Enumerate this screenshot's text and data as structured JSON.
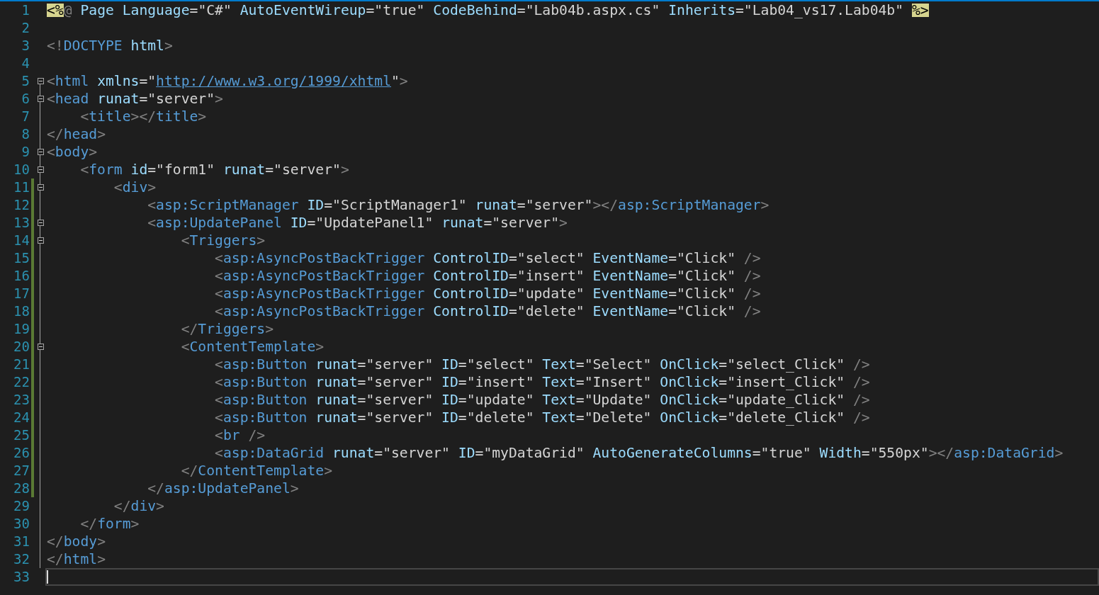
{
  "editor": {
    "lines": [
      {
        "number": "1",
        "collapsible": false,
        "guide": false,
        "modified": false,
        "current": false,
        "tokens": [
          {
            "kind": "directive",
            "text": "<%"
          },
          {
            "kind": "delim",
            "text": "@ "
          },
          {
            "kind": "attr",
            "text": "Page Language"
          },
          {
            "kind": "value",
            "text": "=\"C#\" "
          },
          {
            "kind": "attr",
            "text": "AutoEventWireup"
          },
          {
            "kind": "value",
            "text": "=\"true\" "
          },
          {
            "kind": "attr",
            "text": "CodeBehind"
          },
          {
            "kind": "value",
            "text": "=\"Lab04b.aspx.cs\" "
          },
          {
            "kind": "attr",
            "text": "Inherits"
          },
          {
            "kind": "value",
            "text": "=\"Lab04_vs17.Lab04b\" "
          },
          {
            "kind": "directive",
            "text": "%>"
          }
        ]
      },
      {
        "number": "2",
        "collapsible": false,
        "guide": false,
        "modified": false,
        "current": false
      },
      {
        "number": "3",
        "collapsible": false,
        "guide": false,
        "modified": false,
        "current": false,
        "tokens": [
          {
            "kind": "delim",
            "text": "<!"
          },
          {
            "kind": "tag",
            "text": "DOCTYPE "
          },
          {
            "kind": "attr",
            "text": "html"
          },
          {
            "kind": "delim",
            "text": ">"
          }
        ]
      },
      {
        "number": "4",
        "collapsible": false,
        "guide": false,
        "modified": false,
        "current": false
      },
      {
        "number": "5",
        "collapsible": true,
        "guide": false,
        "modified": false,
        "current": false,
        "tokens": [
          {
            "kind": "delim",
            "text": "<"
          },
          {
            "kind": "tag",
            "text": "html "
          },
          {
            "kind": "attr",
            "text": "xmlns"
          },
          {
            "kind": "value",
            "text": "=\""
          },
          {
            "kind": "link",
            "text": "http://www.w3.org/1999/xhtml"
          },
          {
            "kind": "value",
            "text": "\""
          },
          {
            "kind": "delim",
            "text": ">"
          }
        ]
      },
      {
        "number": "6",
        "collapsible": true,
        "guide": true,
        "modified": false,
        "current": false,
        "tokens": [
          {
            "kind": "delim",
            "text": "<"
          },
          {
            "kind": "tag",
            "text": "head "
          },
          {
            "kind": "attr",
            "text": "runat"
          },
          {
            "kind": "value",
            "text": "=\"server\""
          },
          {
            "kind": "delim",
            "text": ">"
          }
        ]
      },
      {
        "number": "7",
        "collapsible": false,
        "guide": true,
        "modified": false,
        "current": false,
        "tokens": [
          {
            "kind": "delim",
            "text": "    <"
          },
          {
            "kind": "tag",
            "text": "title"
          },
          {
            "kind": "delim",
            "text": "></"
          },
          {
            "kind": "tag",
            "text": "title"
          },
          {
            "kind": "delim",
            "text": ">"
          }
        ]
      },
      {
        "number": "8",
        "collapsible": false,
        "guide": true,
        "modified": false,
        "current": false,
        "tokens": [
          {
            "kind": "delim",
            "text": "</"
          },
          {
            "kind": "tag",
            "text": "head"
          },
          {
            "kind": "delim",
            "text": ">"
          }
        ]
      },
      {
        "number": "9",
        "collapsible": true,
        "guide": true,
        "modified": false,
        "current": false,
        "tokens": [
          {
            "kind": "delim",
            "text": "<"
          },
          {
            "kind": "tag",
            "text": "body"
          },
          {
            "kind": "delim",
            "text": ">"
          }
        ]
      },
      {
        "number": "10",
        "collapsible": true,
        "guide": true,
        "modified": false,
        "current": false,
        "tokens": [
          {
            "kind": "delim",
            "text": "    <"
          },
          {
            "kind": "tag",
            "text": "form "
          },
          {
            "kind": "attr",
            "text": "id"
          },
          {
            "kind": "value",
            "text": "=\"form1\" "
          },
          {
            "kind": "attr",
            "text": "runat"
          },
          {
            "kind": "value",
            "text": "=\"server\""
          },
          {
            "kind": "delim",
            "text": ">"
          }
        ]
      },
      {
        "number": "11",
        "collapsible": true,
        "guide": true,
        "modified": true,
        "current": false,
        "tokens": [
          {
            "kind": "delim",
            "text": "        <"
          },
          {
            "kind": "tag",
            "text": "div"
          },
          {
            "kind": "delim",
            "text": ">"
          }
        ]
      },
      {
        "number": "12",
        "collapsible": false,
        "guide": true,
        "modified": true,
        "current": false,
        "tokens": [
          {
            "kind": "delim",
            "text": "            <"
          },
          {
            "kind": "tag",
            "text": "asp:ScriptManager "
          },
          {
            "kind": "attr",
            "text": "ID"
          },
          {
            "kind": "value",
            "text": "=\"ScriptManager1\" "
          },
          {
            "kind": "attr",
            "text": "runat"
          },
          {
            "kind": "value",
            "text": "=\"server\""
          },
          {
            "kind": "delim",
            "text": "></"
          },
          {
            "kind": "tag",
            "text": "asp:ScriptManager"
          },
          {
            "kind": "delim",
            "text": ">"
          }
        ]
      },
      {
        "number": "13",
        "collapsible": true,
        "guide": true,
        "modified": true,
        "current": false,
        "tokens": [
          {
            "kind": "delim",
            "text": "            <"
          },
          {
            "kind": "tag",
            "text": "asp:UpdatePanel "
          },
          {
            "kind": "attr",
            "text": "ID"
          },
          {
            "kind": "value",
            "text": "=\"UpdatePanel1\" "
          },
          {
            "kind": "attr",
            "text": "runat"
          },
          {
            "kind": "value",
            "text": "=\"server\""
          },
          {
            "kind": "delim",
            "text": ">"
          }
        ]
      },
      {
        "number": "14",
        "collapsible": true,
        "guide": true,
        "modified": true,
        "current": false,
        "tokens": [
          {
            "kind": "delim",
            "text": "                <"
          },
          {
            "kind": "tag",
            "text": "Triggers"
          },
          {
            "kind": "delim",
            "text": ">"
          }
        ]
      },
      {
        "number": "15",
        "collapsible": false,
        "guide": true,
        "modified": true,
        "current": false,
        "tokens": [
          {
            "kind": "delim",
            "text": "                    <"
          },
          {
            "kind": "tag",
            "text": "asp:AsyncPostBackTrigger "
          },
          {
            "kind": "attr",
            "text": "ControlID"
          },
          {
            "kind": "value",
            "text": "=\"select\" "
          },
          {
            "kind": "attr",
            "text": "EventName"
          },
          {
            "kind": "value",
            "text": "=\"Click\" "
          },
          {
            "kind": "delim",
            "text": "/>"
          }
        ]
      },
      {
        "number": "16",
        "collapsible": false,
        "guide": true,
        "modified": true,
        "current": false,
        "tokens": [
          {
            "kind": "delim",
            "text": "                    <"
          },
          {
            "kind": "tag",
            "text": "asp:AsyncPostBackTrigger "
          },
          {
            "kind": "attr",
            "text": "ControlID"
          },
          {
            "kind": "value",
            "text": "=\"insert\" "
          },
          {
            "kind": "attr",
            "text": "EventName"
          },
          {
            "kind": "value",
            "text": "=\"Click\" "
          },
          {
            "kind": "delim",
            "text": "/>"
          }
        ]
      },
      {
        "number": "17",
        "collapsible": false,
        "guide": true,
        "modified": true,
        "current": false,
        "tokens": [
          {
            "kind": "delim",
            "text": "                    <"
          },
          {
            "kind": "tag",
            "text": "asp:AsyncPostBackTrigger "
          },
          {
            "kind": "attr",
            "text": "ControlID"
          },
          {
            "kind": "value",
            "text": "=\"update\" "
          },
          {
            "kind": "attr",
            "text": "EventName"
          },
          {
            "kind": "value",
            "text": "=\"Click\" "
          },
          {
            "kind": "delim",
            "text": "/>"
          }
        ]
      },
      {
        "number": "18",
        "collapsible": false,
        "guide": true,
        "modified": true,
        "current": false,
        "tokens": [
          {
            "kind": "delim",
            "text": "                    <"
          },
          {
            "kind": "tag",
            "text": "asp:AsyncPostBackTrigger "
          },
          {
            "kind": "attr",
            "text": "ControlID"
          },
          {
            "kind": "value",
            "text": "=\"delete\" "
          },
          {
            "kind": "attr",
            "text": "EventName"
          },
          {
            "kind": "value",
            "text": "=\"Click\" "
          },
          {
            "kind": "delim",
            "text": "/>"
          }
        ]
      },
      {
        "number": "19",
        "collapsible": false,
        "guide": true,
        "modified": true,
        "current": false,
        "tokens": [
          {
            "kind": "delim",
            "text": "                </"
          },
          {
            "kind": "tag",
            "text": "Triggers"
          },
          {
            "kind": "delim",
            "text": ">"
          }
        ]
      },
      {
        "number": "20",
        "collapsible": true,
        "guide": true,
        "modified": true,
        "current": false,
        "tokens": [
          {
            "kind": "delim",
            "text": "                <"
          },
          {
            "kind": "tag",
            "text": "ContentTemplate"
          },
          {
            "kind": "delim",
            "text": ">"
          }
        ]
      },
      {
        "number": "21",
        "collapsible": false,
        "guide": true,
        "modified": true,
        "current": false,
        "tokens": [
          {
            "kind": "delim",
            "text": "                    <"
          },
          {
            "kind": "tag",
            "text": "asp:Button "
          },
          {
            "kind": "attr",
            "text": "runat"
          },
          {
            "kind": "value",
            "text": "=\"server\" "
          },
          {
            "kind": "attr",
            "text": "ID"
          },
          {
            "kind": "value",
            "text": "=\"select\" "
          },
          {
            "kind": "attr",
            "text": "Text"
          },
          {
            "kind": "value",
            "text": "=\"Select\" "
          },
          {
            "kind": "attr",
            "text": "OnClick"
          },
          {
            "kind": "value",
            "text": "=\"select_Click\" "
          },
          {
            "kind": "delim",
            "text": "/>"
          }
        ]
      },
      {
        "number": "22",
        "collapsible": false,
        "guide": true,
        "modified": true,
        "current": false,
        "tokens": [
          {
            "kind": "delim",
            "text": "                    <"
          },
          {
            "kind": "tag",
            "text": "asp:Button "
          },
          {
            "kind": "attr",
            "text": "runat"
          },
          {
            "kind": "value",
            "text": "=\"server\" "
          },
          {
            "kind": "attr",
            "text": "ID"
          },
          {
            "kind": "value",
            "text": "=\"insert\" "
          },
          {
            "kind": "attr",
            "text": "Text"
          },
          {
            "kind": "value",
            "text": "=\"Insert\" "
          },
          {
            "kind": "attr",
            "text": "OnClick"
          },
          {
            "kind": "value",
            "text": "=\"insert_Click\" "
          },
          {
            "kind": "delim",
            "text": "/>"
          }
        ]
      },
      {
        "number": "23",
        "collapsible": false,
        "guide": true,
        "modified": true,
        "current": false,
        "tokens": [
          {
            "kind": "delim",
            "text": "                    <"
          },
          {
            "kind": "tag",
            "text": "asp:Button "
          },
          {
            "kind": "attr",
            "text": "runat"
          },
          {
            "kind": "value",
            "text": "=\"server\" "
          },
          {
            "kind": "attr",
            "text": "ID"
          },
          {
            "kind": "value",
            "text": "=\"update\" "
          },
          {
            "kind": "attr",
            "text": "Text"
          },
          {
            "kind": "value",
            "text": "=\"Update\" "
          },
          {
            "kind": "attr",
            "text": "OnClick"
          },
          {
            "kind": "value",
            "text": "=\"update_Click\" "
          },
          {
            "kind": "delim",
            "text": "/>"
          }
        ]
      },
      {
        "number": "24",
        "collapsible": false,
        "guide": true,
        "modified": true,
        "current": false,
        "tokens": [
          {
            "kind": "delim",
            "text": "                    <"
          },
          {
            "kind": "tag",
            "text": "asp:Button "
          },
          {
            "kind": "attr",
            "text": "runat"
          },
          {
            "kind": "value",
            "text": "=\"server\" "
          },
          {
            "kind": "attr",
            "text": "ID"
          },
          {
            "kind": "value",
            "text": "=\"delete\" "
          },
          {
            "kind": "attr",
            "text": "Text"
          },
          {
            "kind": "value",
            "text": "=\"Delete\" "
          },
          {
            "kind": "attr",
            "text": "OnClick"
          },
          {
            "kind": "value",
            "text": "=\"delete_Click\" "
          },
          {
            "kind": "delim",
            "text": "/>"
          }
        ]
      },
      {
        "number": "25",
        "collapsible": false,
        "guide": true,
        "modified": true,
        "current": false,
        "tokens": [
          {
            "kind": "delim",
            "text": "                    <"
          },
          {
            "kind": "tag",
            "text": "br "
          },
          {
            "kind": "delim",
            "text": "/>"
          }
        ]
      },
      {
        "number": "26",
        "collapsible": false,
        "guide": true,
        "modified": true,
        "current": false,
        "tokens": [
          {
            "kind": "delim",
            "text": "                    <"
          },
          {
            "kind": "tag",
            "text": "asp:DataGrid "
          },
          {
            "kind": "attr",
            "text": "runat"
          },
          {
            "kind": "value",
            "text": "=\"server\" "
          },
          {
            "kind": "attr",
            "text": "ID"
          },
          {
            "kind": "value",
            "text": "=\"myDataGrid\" "
          },
          {
            "kind": "attr",
            "text": "AutoGenerateColumns"
          },
          {
            "kind": "value",
            "text": "=\"true\" "
          },
          {
            "kind": "attr",
            "text": "Width"
          },
          {
            "kind": "value",
            "text": "=\"550px\""
          },
          {
            "kind": "delim",
            "text": "></"
          },
          {
            "kind": "tag",
            "text": "asp:DataGrid"
          },
          {
            "kind": "delim",
            "text": ">"
          }
        ]
      },
      {
        "number": "27",
        "collapsible": false,
        "guide": true,
        "modified": true,
        "current": false,
        "tokens": [
          {
            "kind": "delim",
            "text": "                </"
          },
          {
            "kind": "tag",
            "text": "ContentTemplate"
          },
          {
            "kind": "delim",
            "text": ">"
          }
        ]
      },
      {
        "number": "28",
        "collapsible": false,
        "guide": true,
        "modified": true,
        "current": false,
        "tokens": [
          {
            "kind": "delim",
            "text": "            </"
          },
          {
            "kind": "tag",
            "text": "asp:UpdatePanel"
          },
          {
            "kind": "delim",
            "text": ">"
          }
        ]
      },
      {
        "number": "29",
        "collapsible": false,
        "guide": true,
        "modified": false,
        "current": false,
        "tokens": [
          {
            "kind": "delim",
            "text": "        </"
          },
          {
            "kind": "tag",
            "text": "div"
          },
          {
            "kind": "delim",
            "text": ">"
          }
        ]
      },
      {
        "number": "30",
        "collapsible": false,
        "guide": true,
        "modified": false,
        "current": false,
        "tokens": [
          {
            "kind": "delim",
            "text": "    </"
          },
          {
            "kind": "tag",
            "text": "form"
          },
          {
            "kind": "delim",
            "text": ">"
          }
        ]
      },
      {
        "number": "31",
        "collapsible": false,
        "guide": true,
        "modified": false,
        "current": false,
        "tokens": [
          {
            "kind": "delim",
            "text": "</"
          },
          {
            "kind": "tag",
            "text": "body"
          },
          {
            "kind": "delim",
            "text": ">"
          }
        ]
      },
      {
        "number": "32",
        "collapsible": false,
        "guide": true,
        "modified": false,
        "current": false,
        "tokens": [
          {
            "kind": "delim",
            "text": "</"
          },
          {
            "kind": "tag",
            "text": "html"
          },
          {
            "kind": "delim",
            "text": ">"
          }
        ]
      },
      {
        "number": "33",
        "collapsible": false,
        "guide": false,
        "modified": false,
        "current": true
      }
    ]
  }
}
